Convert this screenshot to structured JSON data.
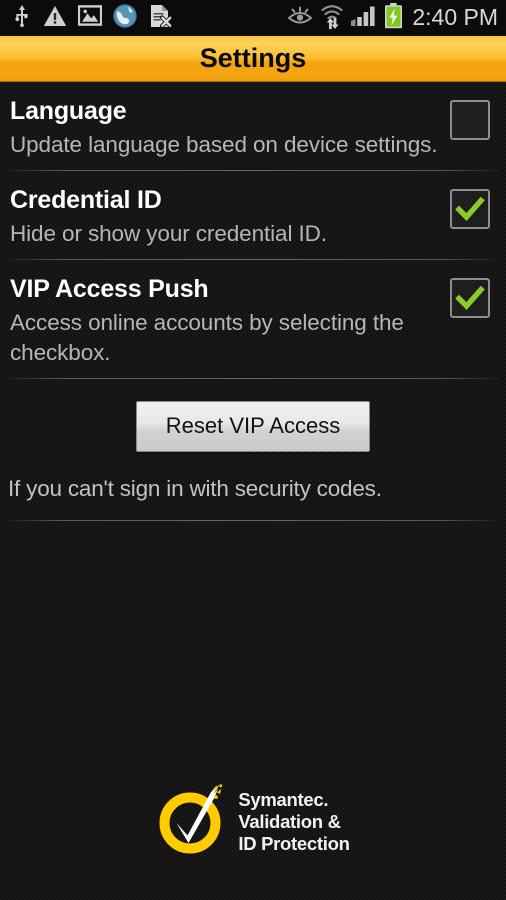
{
  "status_bar": {
    "icons_left": [
      "usb-icon",
      "warning-icon",
      "image-icon",
      "globe-icon",
      "sim-card-error-icon"
    ],
    "icons_right": [
      "eye-disabled-icon",
      "wifi-transfer-icon",
      "signal-bars-icon",
      "battery-charging-icon"
    ],
    "clock": "2:40 PM"
  },
  "title_bar": {
    "title": "Settings",
    "accent_color": "#f5a50f"
  },
  "preferences": [
    {
      "title": "Language",
      "summary": "Update language based on device settings.",
      "checked": false
    },
    {
      "title": "Credential ID",
      "summary": "Hide or show your credential ID.",
      "checked": true
    },
    {
      "title": "VIP Access Push",
      "summary": "Access online accounts by selecting the checkbox.",
      "checked": true
    }
  ],
  "reset_button": {
    "label": "Reset VIP Access"
  },
  "signin_note": "If you can't sign in with security codes.",
  "logo": {
    "mark": "symantec-checkmark-icon",
    "line1": "Symantec.",
    "line2": "Validation &",
    "line3": "ID Protection",
    "brand_color": "#ffcc00"
  },
  "colors": {
    "check_green": "#8ccc28",
    "background": "#1c1c1c"
  }
}
